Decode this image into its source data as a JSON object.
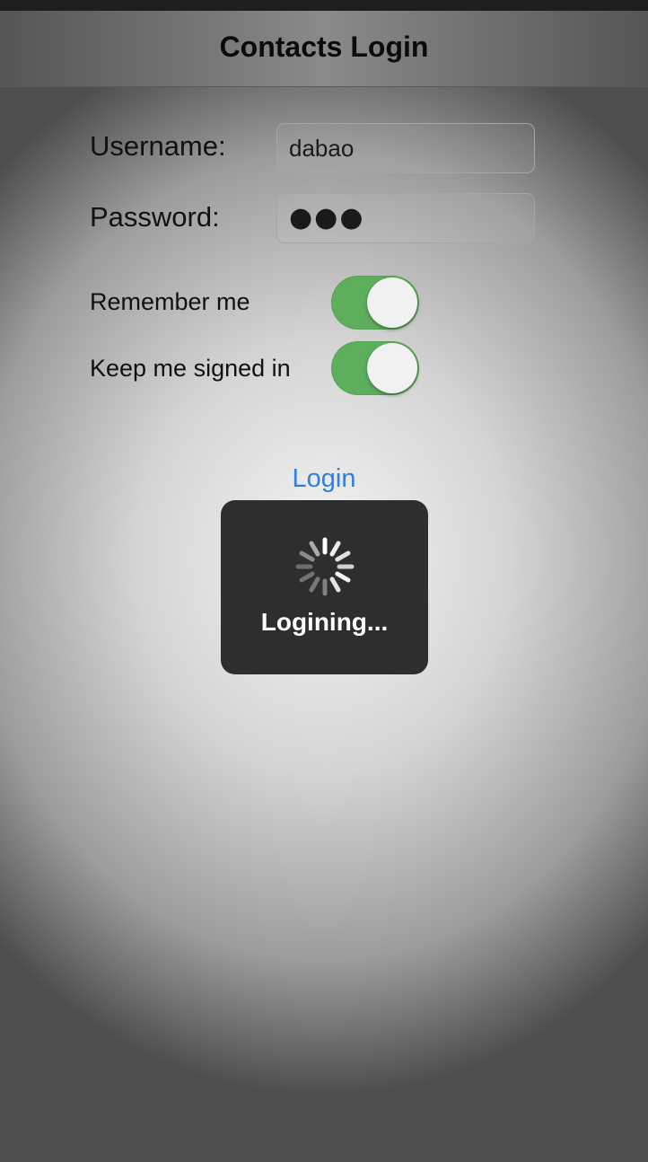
{
  "nav": {
    "title": "Contacts Login"
  },
  "form": {
    "username_label": "Username:",
    "username_value": "dabao",
    "password_label": "Password:",
    "password_value": "●●●"
  },
  "switches": {
    "remember_label": "Remember me",
    "remember_on": true,
    "keep_signed_label": "Keep me signed in",
    "keep_signed_on": true
  },
  "actions": {
    "login_label": "Login"
  },
  "hud": {
    "message": "Logining...",
    "icon": "activity-spinner-icon"
  },
  "colors": {
    "accent": "#2f7fe0",
    "switch_on": "#5daf5d",
    "hud_bg": "#2e2e2e"
  }
}
